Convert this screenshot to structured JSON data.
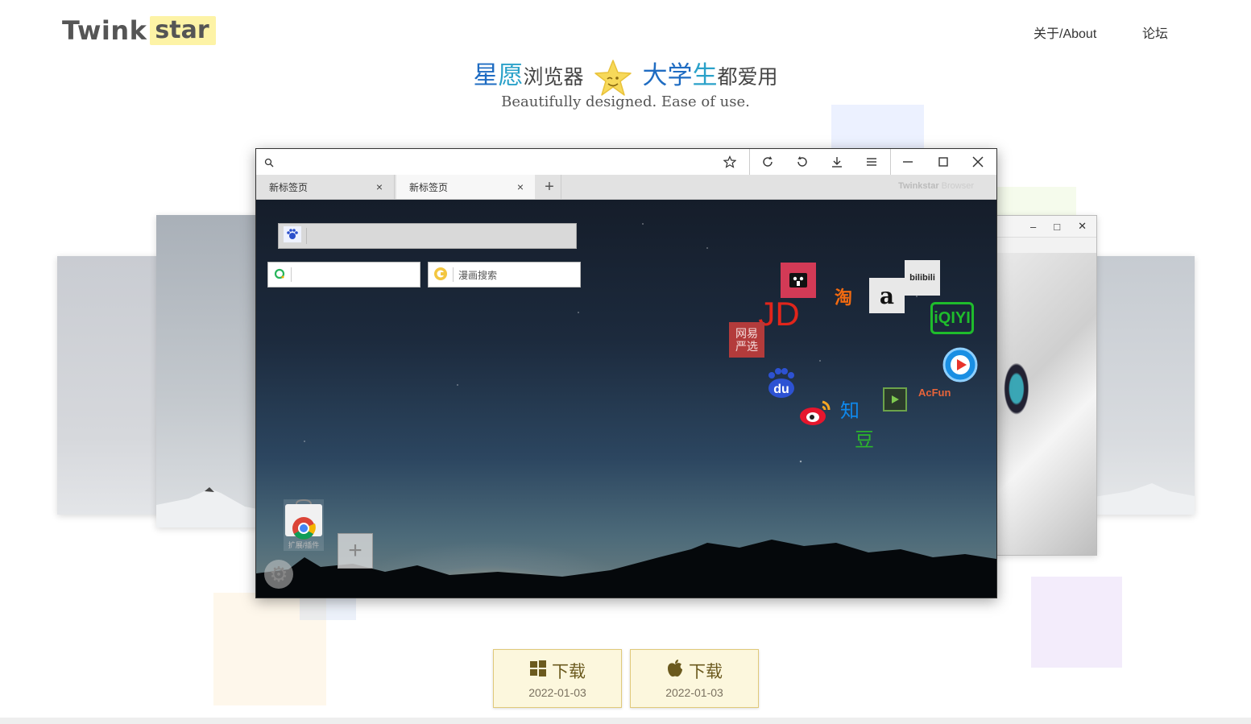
{
  "header": {
    "logo_left": "Twink",
    "logo_right": "star",
    "nav": [
      {
        "label": "关于/About"
      },
      {
        "label": "论坛"
      }
    ]
  },
  "hero": {
    "slogan_part1": "星",
    "slogan_part2": "愿",
    "slogan_part3": "浏览器",
    "slogan_part4": "大学",
    "slogan_part5": "生",
    "slogan_part6": "都爱用",
    "subtitle": "Beautifully designed. Ease of use."
  },
  "browser": {
    "tabs": [
      {
        "label": "新标签页",
        "close": "×"
      },
      {
        "label": "新标签页",
        "close": "×"
      }
    ],
    "new_tab": "+",
    "brand_bold": "Twinkstar",
    "brand_thin": " Browser",
    "controls": [
      "star-icon",
      "refresh-icon",
      "undo-icon",
      "download-icon",
      "menu-icon",
      "minimize-icon",
      "maximize-icon",
      "close-icon"
    ],
    "search_boxes": [
      {
        "icon": "baidu-icon",
        "placeholder": ""
      },
      {
        "icon": "green-search-icon",
        "placeholder": ""
      },
      {
        "icon": "comic-search-icon",
        "placeholder": "漫画搜索"
      }
    ],
    "sites": [
      {
        "name": "tmall",
        "text": "天猫"
      },
      {
        "name": "taobao",
        "text": "淘"
      },
      {
        "name": "amazon",
        "text": "a"
      },
      {
        "name": "bilibili",
        "text": "bilibili"
      },
      {
        "name": "jd",
        "text": "JD"
      },
      {
        "name": "iqiyi",
        "text": "iQIYI"
      },
      {
        "name": "netease-yanxuan",
        "text": "网易严选"
      },
      {
        "name": "baidu",
        "text": "du"
      },
      {
        "name": "zhihu",
        "text": "知"
      },
      {
        "name": "douban",
        "text": "豆"
      },
      {
        "name": "acfun",
        "text": "AcFun"
      }
    ],
    "ext_label": "扩展/插件",
    "add_label": "+"
  },
  "downloads": [
    {
      "platform": "windows",
      "label": "下载",
      "date": "2022-01-03"
    },
    {
      "platform": "mac",
      "label": "下载",
      "date": "2022-01-03"
    }
  ],
  "colors": {
    "slogan_blue": "#1f6cc2",
    "slogan_cyan": "#2aa1c9",
    "download_bg": "#fcf7dd",
    "download_border": "#e0c97a",
    "logo_highlight": "#fdf3a6"
  }
}
